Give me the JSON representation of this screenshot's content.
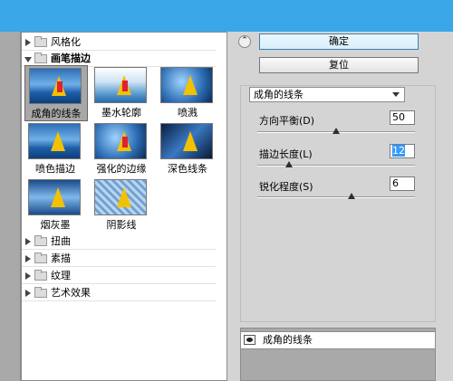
{
  "gallery": {
    "categories_top": [
      {
        "label": "风格化",
        "expanded": false
      },
      {
        "label": "画笔描边",
        "expanded": true
      }
    ],
    "thumbnails": [
      {
        "label": "成角的线条",
        "selected": true,
        "icon": "thumb-image"
      },
      {
        "label": "墨水轮廓",
        "selected": false,
        "icon": "thumb-image"
      },
      {
        "label": "喷溅",
        "selected": false,
        "icon": "thumb-image"
      },
      {
        "label": "喷色描边",
        "selected": false,
        "icon": "thumb-image"
      },
      {
        "label": "强化的边缘",
        "selected": false,
        "icon": "thumb-image"
      },
      {
        "label": "深色线条",
        "selected": false,
        "icon": "thumb-image"
      },
      {
        "label": "烟灰墨",
        "selected": false,
        "icon": "thumb-image"
      },
      {
        "label": "阴影线",
        "selected": false,
        "icon": "thumb-image"
      }
    ],
    "categories_bottom": [
      {
        "label": "扭曲",
        "expanded": false
      },
      {
        "label": "素描",
        "expanded": false
      },
      {
        "label": "纹理",
        "expanded": false
      },
      {
        "label": "艺术效果",
        "expanded": false
      }
    ]
  },
  "actions": {
    "ok_label": "确定",
    "reset_label": "复位"
  },
  "filter_select": {
    "value": "成角的线条"
  },
  "params": [
    {
      "label": "方向平衡(D)",
      "value": "50",
      "slider_fraction": 0.5
    },
    {
      "label": "描边长度(L)",
      "value": "12",
      "slider_fraction": 0.2
    },
    {
      "label": "锐化程度(S)",
      "value": "6",
      "slider_fraction": 0.6
    }
  ],
  "layers": {
    "row_label": "成角的线条"
  },
  "colors": {
    "titlebar": "#3aa7e8",
    "panel": "#d4d4d4",
    "selection": "#3399ff"
  }
}
